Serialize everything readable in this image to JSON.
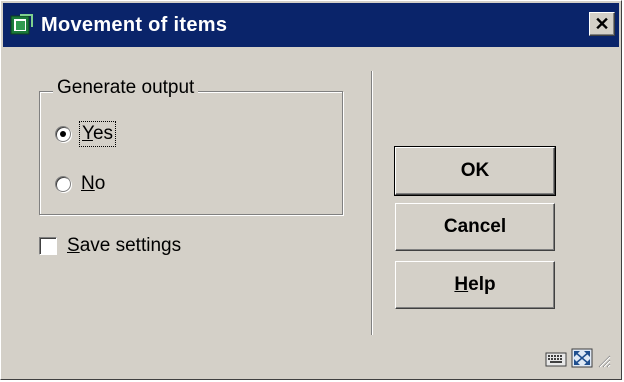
{
  "window": {
    "title": "Movement of items",
    "close_symbol": "✕"
  },
  "group": {
    "legend": "Generate output",
    "options": [
      {
        "first": "Y",
        "rest": "es",
        "checked": true
      },
      {
        "first": "N",
        "rest": "o",
        "checked": false
      }
    ]
  },
  "save_settings": {
    "first": "S",
    "rest": "ave settings",
    "checked": false
  },
  "buttons": {
    "ok": "OK",
    "cancel": "Cancel",
    "help_first": "H",
    "help_rest": "elp"
  },
  "icons": {
    "app": "app-window-icon",
    "status": [
      "keyboard-icon",
      "maximize-icon",
      "resize-grip-icon"
    ]
  },
  "colors": {
    "titlebar": "#0a246a",
    "face": "#d4d0c8"
  }
}
